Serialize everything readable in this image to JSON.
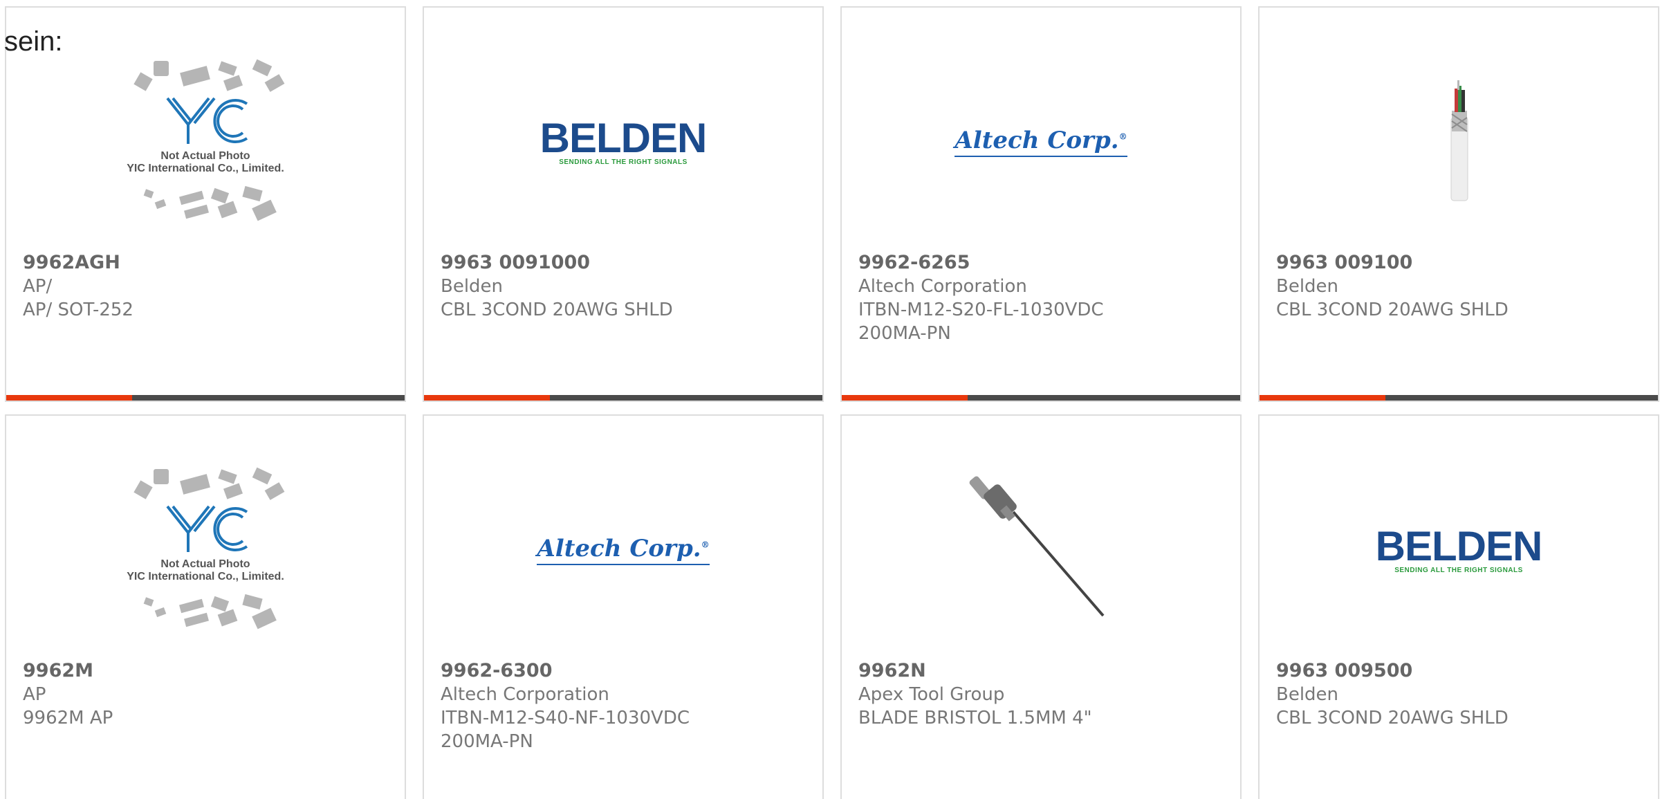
{
  "intro_text": "sein:",
  "colors": {
    "accent": "#e8380d",
    "bar": "#4a4a4a",
    "border": "#dddddd",
    "text": "#777777"
  },
  "logos": {
    "yic_line1": "Not Actual Photo",
    "yic_line2": "YIC International Co., Limited.",
    "yic_mark": "YIC",
    "belden_word": "BELDEN",
    "belden_tag": "SENDING ALL THE RIGHT SIGNALS",
    "altech_word": "Altech Corp."
  },
  "products": [
    {
      "part_number": "9962AGH",
      "manufacturer": "AP/",
      "description": "AP/ SOT-252",
      "image": "yic-placeholder"
    },
    {
      "part_number": "9963 0091000",
      "manufacturer": "Belden",
      "description": "CBL 3COND 20AWG SHLD",
      "image": "belden-logo"
    },
    {
      "part_number": "9962-6265",
      "manufacturer": "Altech Corporation",
      "description": "ITBN-M12-S20-FL-1030VDC 200MA-PN",
      "image": "altech-logo"
    },
    {
      "part_number": "9963 009100",
      "manufacturer": "Belden",
      "description": "CBL 3COND 20AWG SHLD",
      "image": "cable-photo"
    },
    {
      "part_number": "9962M",
      "manufacturer": "AP",
      "description": "9962M AP",
      "image": "yic-placeholder"
    },
    {
      "part_number": "9962-6300",
      "manufacturer": "Altech Corporation",
      "description": "ITBN-M12-S40-NF-1030VDC 200MA-PN",
      "image": "altech-logo"
    },
    {
      "part_number": "9962N",
      "manufacturer": "Apex Tool Group",
      "description": "BLADE BRISTOL 1.5MM 4\"",
      "image": "blade-photo"
    },
    {
      "part_number": "9963 009500",
      "manufacturer": "Belden",
      "description": "CBL 3COND 20AWG SHLD",
      "image": "belden-logo"
    }
  ]
}
